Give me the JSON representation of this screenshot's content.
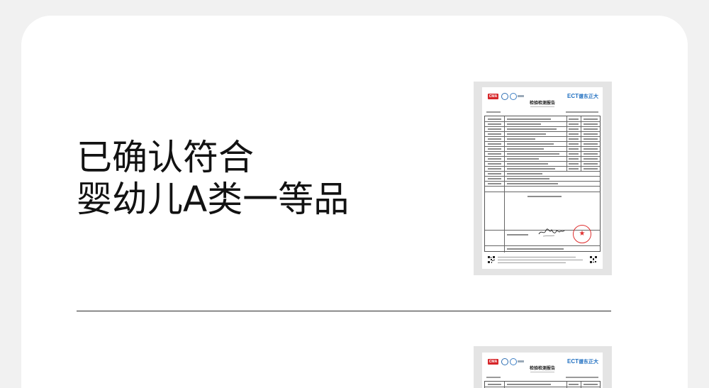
{
  "headline": {
    "line1": "已确认符合",
    "line2": "婴幼儿A类一等品"
  },
  "reports": [
    {
      "badge": "CMA",
      "brand_mark": "ECT",
      "brand_name": "谱东正大",
      "title": "检验检测报告"
    },
    {
      "badge": "CMA",
      "brand_mark": "ECT",
      "brand_name": "谱东正大",
      "title": "检验检测报告"
    }
  ],
  "colors": {
    "page_background": "#f1f1f1",
    "card_background": "#ffffff",
    "headline_text": "#121212",
    "report_frame": "#e4e4e4",
    "brand_blue": "#1f6fc0",
    "stamp_red": "#e03030",
    "badge_red": "#d6262a"
  },
  "icons": {
    "stamp": "official-seal-icon",
    "qr": "qr-code-icon",
    "accreditation": "accreditation-seal-icon"
  }
}
